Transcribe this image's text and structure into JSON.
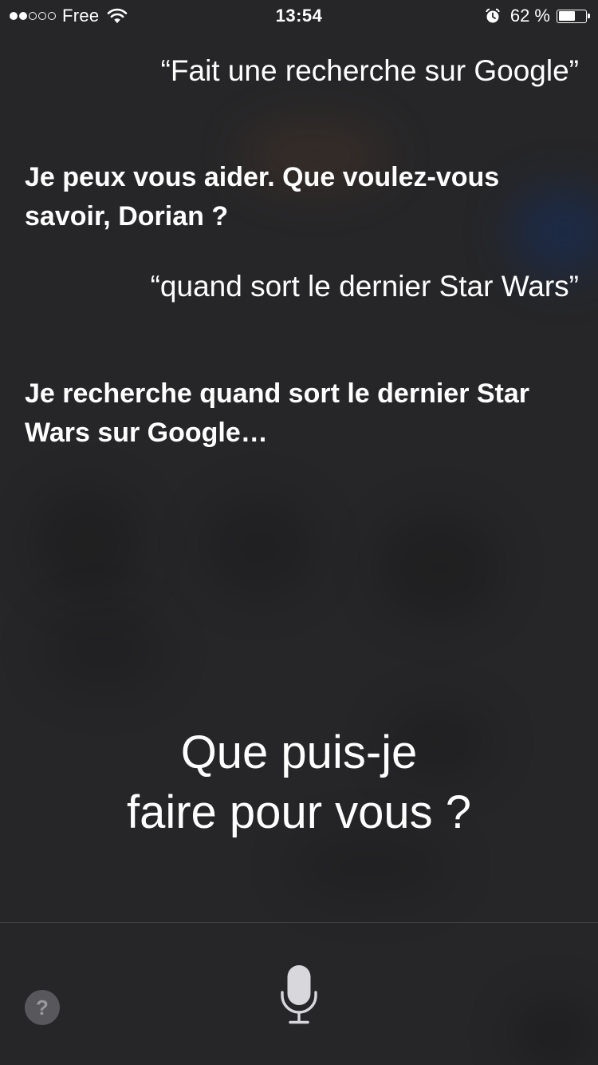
{
  "status_bar": {
    "carrier": "Free",
    "time": "13:54",
    "battery_percent": "62 %",
    "battery_level": 0.62,
    "signal_strength": 2,
    "signal_total": 5
  },
  "conversation": [
    {
      "speaker": "user",
      "text": "“Fait une recherche sur Google”"
    },
    {
      "speaker": "siri",
      "text": "Je peux vous aider. Que voulez-vous savoir, Dorian ?"
    },
    {
      "speaker": "user",
      "text": "“quand sort le dernier Star Wars”"
    },
    {
      "speaker": "siri",
      "text": "Je recherche quand sort le dernier Star Wars sur Google…"
    }
  ],
  "prompt": {
    "line1": "Que puis-je",
    "line2": "faire pour vous ?"
  },
  "bottom_bar": {
    "help_label": "?"
  },
  "icons": {
    "wifi": "wifi-icon",
    "alarm": "alarm-icon",
    "battery": "battery-icon",
    "microphone": "microphone-icon"
  }
}
